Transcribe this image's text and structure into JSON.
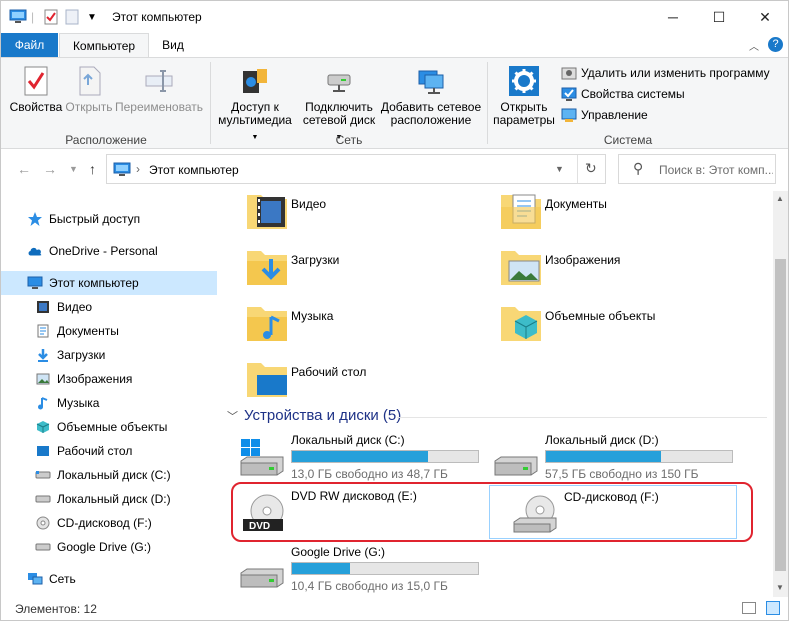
{
  "window": {
    "title": "Этот компьютер",
    "minimize": "─",
    "maximize": "☐",
    "close": "✕"
  },
  "ribbon_tabs": [
    {
      "label": "Файл"
    },
    {
      "label": "Компьютер"
    },
    {
      "label": "Вид"
    }
  ],
  "ribbon": {
    "location": {
      "label": "Расположение",
      "buttons": [
        {
          "label": "Свойства"
        },
        {
          "label": "Открыть"
        },
        {
          "label": "Переименовать"
        }
      ]
    },
    "network": {
      "label": "Сеть",
      "buttons": [
        {
          "line1": "Доступ к",
          "line2": "мультимедиа"
        },
        {
          "line1": "Подключить",
          "line2": "сетевой диск"
        },
        {
          "line1": "Добавить сетевое",
          "line2": "расположение"
        }
      ]
    },
    "system": {
      "label": "Система",
      "open_settings": {
        "line1": "Открыть",
        "line2": "параметры"
      },
      "commands": [
        {
          "label": "Удалить или изменить программу"
        },
        {
          "label": "Свойства системы"
        },
        {
          "label": "Управление"
        }
      ]
    }
  },
  "address": {
    "path": "Этот компьютер",
    "search_placeholder": "Поиск в: Этот комп..."
  },
  "nav": {
    "items": [
      {
        "label": "Быстрый доступ"
      },
      {
        "label": "OneDrive - Personal"
      },
      {
        "label": "Этот компьютер"
      },
      {
        "label": "Видео"
      },
      {
        "label": "Документы"
      },
      {
        "label": "Загрузки"
      },
      {
        "label": "Изображения"
      },
      {
        "label": "Музыка"
      },
      {
        "label": "Объемные объекты"
      },
      {
        "label": "Рабочий стол"
      },
      {
        "label": "Локальный диск (C:)"
      },
      {
        "label": "Локальный диск (D:)"
      },
      {
        "label": "CD-дисковод (F:)"
      },
      {
        "label": "Google Drive (G:)"
      },
      {
        "label": "Сеть"
      }
    ]
  },
  "folders": [
    {
      "label": "Видео"
    },
    {
      "label": "Документы"
    },
    {
      "label": "Загрузки"
    },
    {
      "label": "Изображения"
    },
    {
      "label": "Музыка"
    },
    {
      "label": "Объемные объекты"
    },
    {
      "label": "Рабочий стол"
    }
  ],
  "devices": {
    "header": "Устройства и диски (5)",
    "items": [
      {
        "label": "Локальный диск (C:)",
        "free": "13,0 ГБ свободно из 48,7 ГБ",
        "used_fraction": 0.73
      },
      {
        "label": "Локальный диск (D:)",
        "free": "57,5 ГБ свободно из 150 ГБ",
        "used_fraction": 0.62
      },
      {
        "label": "DVD RW дисковод (E:)",
        "badge": "DVD"
      },
      {
        "label": "CD-дисковод (F:)"
      },
      {
        "label": "Google Drive (G:)",
        "free": "10,4 ГБ свободно из 15,0 ГБ",
        "used_fraction": 0.31
      }
    ]
  },
  "status": {
    "items_count": "Элементов: 12"
  },
  "colors": {
    "accent": "#1979ca",
    "selection": "#cce8ff",
    "bar_fill": "#26a0da",
    "highlight": "#e0242f",
    "section_text": "#1e3287"
  }
}
